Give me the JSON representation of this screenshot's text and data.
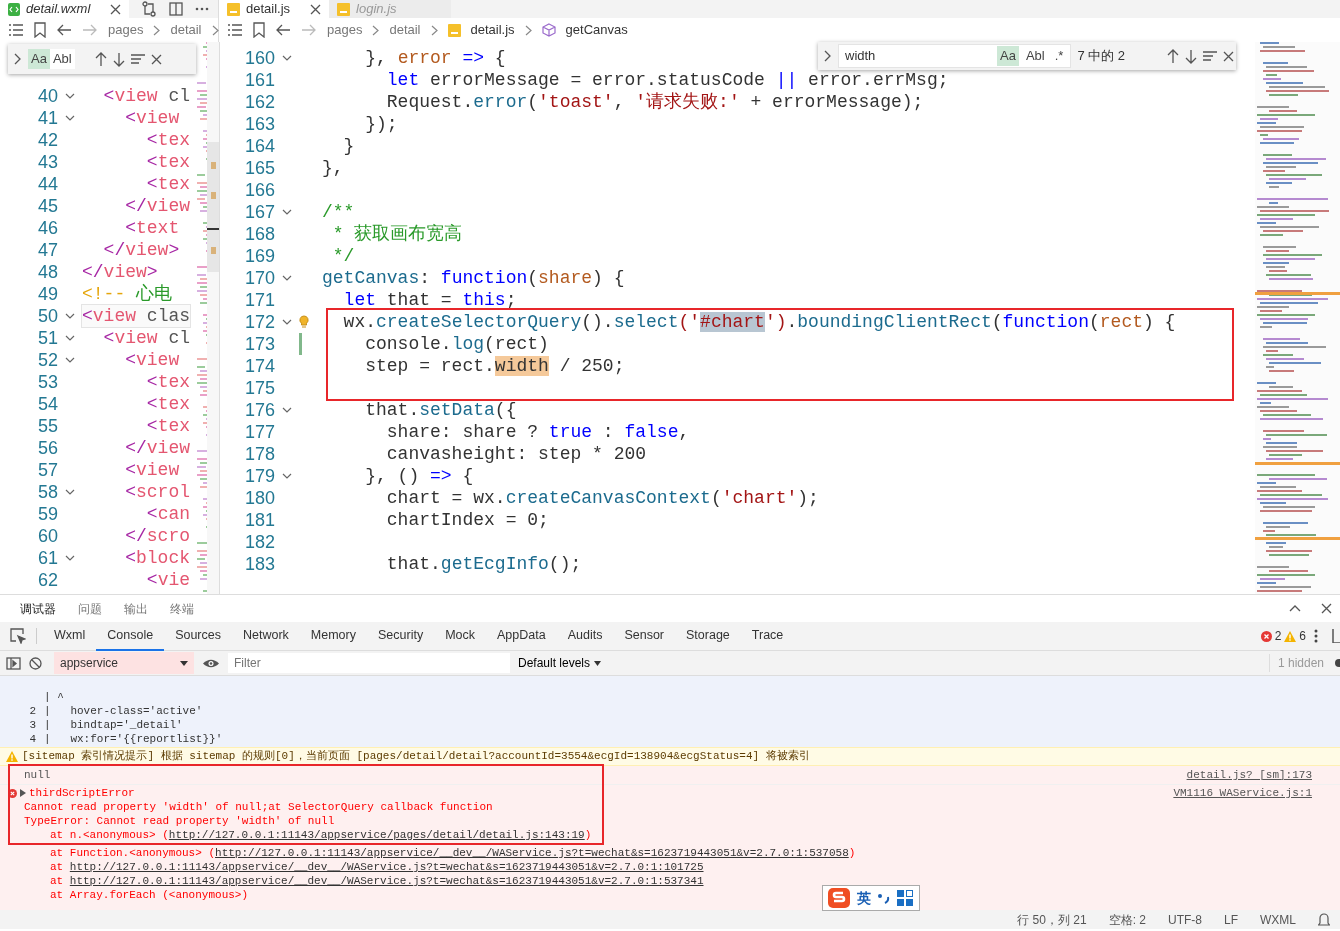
{
  "editor_left": {
    "tabs": [
      {
        "label": "detail.wxml",
        "selected": true,
        "preview": true
      }
    ],
    "crumbs": [
      "pages",
      "detail"
    ],
    "find": {
      "toggles": [
        {
          "label": "Aa",
          "selected": true
        },
        {
          "label": "Abl",
          "selected": false
        }
      ]
    },
    "lines": [
      {
        "n": "40",
        "fold": true,
        "current": false,
        "tokens": [
          {
            "text": "  <",
            "kind": "t"
          },
          {
            "text": "view",
            "kind": "tg"
          },
          {
            "text": " cl",
            "kind": "at"
          }
        ]
      },
      {
        "n": "41",
        "fold": true,
        "current": false,
        "tokens": [
          {
            "text": "    <",
            "kind": "t"
          },
          {
            "text": "view",
            "kind": "tg"
          }
        ]
      },
      {
        "n": "42",
        "fold": false,
        "current": false,
        "tokens": [
          {
            "text": "      <",
            "kind": "t"
          },
          {
            "text": "tex",
            "kind": "tg"
          }
        ]
      },
      {
        "n": "43",
        "fold": false,
        "current": false,
        "tokens": [
          {
            "text": "      <",
            "kind": "t"
          },
          {
            "text": "tex",
            "kind": "tg"
          }
        ]
      },
      {
        "n": "44",
        "fold": false,
        "current": false,
        "tokens": [
          {
            "text": "      <",
            "kind": "t"
          },
          {
            "text": "tex",
            "kind": "tg"
          }
        ]
      },
      {
        "n": "45",
        "fold": false,
        "current": false,
        "tokens": [
          {
            "text": "    </",
            "kind": "t"
          },
          {
            "text": "view",
            "kind": "tg"
          }
        ]
      },
      {
        "n": "46",
        "fold": false,
        "current": false,
        "tokens": [
          {
            "text": "    <",
            "kind": "t"
          },
          {
            "text": "text",
            "kind": "tg"
          }
        ]
      },
      {
        "n": "47",
        "fold": false,
        "current": false,
        "tokens": [
          {
            "text": "  </",
            "kind": "t"
          },
          {
            "text": "view",
            "kind": "tg"
          },
          {
            "text": ">",
            "kind": "t"
          }
        ]
      },
      {
        "n": "48",
        "fold": false,
        "current": false,
        "tokens": [
          {
            "text": "</",
            "kind": "t"
          },
          {
            "text": "view",
            "kind": "tg"
          },
          {
            "text": ">",
            "kind": "t"
          }
        ]
      },
      {
        "n": "49",
        "fold": false,
        "current": false,
        "tokens": [
          {
            "text": "<!-- ",
            "kind": "cp"
          },
          {
            "text": "心电",
            "kind": "cm"
          }
        ]
      },
      {
        "n": "50",
        "fold": true,
        "current": true,
        "tokens": [
          {
            "text": "<",
            "kind": "t"
          },
          {
            "text": "view",
            "kind": "tg"
          },
          {
            "text": " clas",
            "kind": "at"
          }
        ]
      },
      {
        "n": "51",
        "fold": true,
        "current": false,
        "tokens": [
          {
            "text": "  <",
            "kind": "t"
          },
          {
            "text": "view",
            "kind": "tg"
          },
          {
            "text": " cl",
            "kind": "at"
          }
        ]
      },
      {
        "n": "52",
        "fold": true,
        "current": false,
        "tokens": [
          {
            "text": "    <",
            "kind": "t"
          },
          {
            "text": "view",
            "kind": "tg"
          }
        ]
      },
      {
        "n": "53",
        "fold": false,
        "current": false,
        "tokens": [
          {
            "text": "      <",
            "kind": "t"
          },
          {
            "text": "tex",
            "kind": "tg"
          }
        ]
      },
      {
        "n": "54",
        "fold": false,
        "current": false,
        "tokens": [
          {
            "text": "      <",
            "kind": "t"
          },
          {
            "text": "tex",
            "kind": "tg"
          }
        ]
      },
      {
        "n": "55",
        "fold": false,
        "current": false,
        "tokens": [
          {
            "text": "      <",
            "kind": "t"
          },
          {
            "text": "tex",
            "kind": "tg"
          }
        ]
      },
      {
        "n": "56",
        "fold": false,
        "current": false,
        "tokens": [
          {
            "text": "    </",
            "kind": "t"
          },
          {
            "text": "view",
            "kind": "tg"
          }
        ]
      },
      {
        "n": "57",
        "fold": false,
        "current": false,
        "tokens": [
          {
            "text": "    <",
            "kind": "t"
          },
          {
            "text": "view",
            "kind": "tg"
          }
        ]
      },
      {
        "n": "58",
        "fold": true,
        "current": false,
        "tokens": [
          {
            "text": "    <",
            "kind": "t"
          },
          {
            "text": "scrol",
            "kind": "tg"
          }
        ]
      },
      {
        "n": "59",
        "fold": false,
        "current": false,
        "tokens": [
          {
            "text": "      <",
            "kind": "t"
          },
          {
            "text": "can",
            "kind": "tg"
          }
        ]
      },
      {
        "n": "60",
        "fold": false,
        "current": false,
        "tokens": [
          {
            "text": "    </",
            "kind": "t"
          },
          {
            "text": "scro",
            "kind": "tg"
          }
        ]
      },
      {
        "n": "61",
        "fold": true,
        "current": false,
        "tokens": [
          {
            "text": "    <",
            "kind": "t"
          },
          {
            "text": "block",
            "kind": "tg"
          }
        ]
      },
      {
        "n": "62",
        "fold": false,
        "current": false,
        "tokens": [
          {
            "text": "      <",
            "kind": "t"
          },
          {
            "text": "vie",
            "kind": "tg"
          }
        ]
      }
    ]
  },
  "editor_right": {
    "tabs": [
      {
        "label": "detail.js",
        "selected": true,
        "preview": false
      },
      {
        "label": "login.js",
        "selected": false,
        "preview": true
      }
    ],
    "crumbs": [
      {
        "label": "pages",
        "kind": "folder"
      },
      {
        "label": "detail",
        "kind": "folder"
      },
      {
        "label": "detail.js",
        "kind": "file"
      },
      {
        "label": "getCanvas",
        "kind": "symbol"
      }
    ],
    "find": {
      "value": "width",
      "count": "7 中的 2",
      "toggles": [
        {
          "label": "Aa",
          "selected": true
        },
        {
          "label": "Abl",
          "selected": false
        },
        {
          "label": ".*",
          "selected": false
        }
      ]
    },
    "lines": [
      {
        "n": "160",
        "fold": true,
        "tokens": [
          {
            "text": "    }, ",
            "kind": "pl"
          },
          {
            "text": "error",
            "kind": "pm"
          },
          {
            "text": " =>",
            "kind": "kw"
          },
          {
            "text": " {",
            "kind": "pl"
          }
        ]
      },
      {
        "n": "161",
        "fold": false,
        "tokens": [
          {
            "text": "      let",
            "kind": "kw"
          },
          {
            "text": " errorMessage = error.statusCode ",
            "kind": "pl"
          },
          {
            "text": "||",
            "kind": "kw"
          },
          {
            "text": " error.errMsg;",
            "kind": "pl"
          }
        ]
      },
      {
        "n": "162",
        "fold": false,
        "tokens": [
          {
            "text": "      Request.",
            "kind": "pl"
          },
          {
            "text": "error",
            "kind": "fn"
          },
          {
            "text": "(",
            "kind": "pl"
          },
          {
            "text": "'toast'",
            "kind": "str"
          },
          {
            "text": ", ",
            "kind": "pl"
          },
          {
            "text": "'请求失败:'",
            "kind": "str"
          },
          {
            "text": " + errorMessage);",
            "kind": "pl"
          }
        ]
      },
      {
        "n": "163",
        "fold": false,
        "tokens": [
          {
            "text": "    });",
            "kind": "pl"
          }
        ]
      },
      {
        "n": "164",
        "fold": false,
        "tokens": [
          {
            "text": "  }",
            "kind": "pl"
          }
        ]
      },
      {
        "n": "165",
        "fold": false,
        "tokens": [
          {
            "text": "},",
            "kind": "pl"
          }
        ]
      },
      {
        "n": "166",
        "fold": false
      },
      {
        "n": "167",
        "fold": true,
        "tokens": [
          {
            "text": "/**",
            "kind": "cm"
          }
        ]
      },
      {
        "n": "168",
        "fold": false,
        "tokens": [
          {
            "text": " * 获取画布宽高",
            "kind": "cm"
          }
        ]
      },
      {
        "n": "169",
        "fold": false,
        "tokens": [
          {
            "text": " */",
            "kind": "cm"
          }
        ]
      },
      {
        "n": "170",
        "fold": true,
        "tokens": [
          {
            "text": "getCanvas",
            "kind": "fn"
          },
          {
            "text": ": ",
            "kind": "pl"
          },
          {
            "text": "function",
            "kind": "kw"
          },
          {
            "text": "(",
            "kind": "pl"
          },
          {
            "text": "share",
            "kind": "pm"
          },
          {
            "text": ") {",
            "kind": "pl"
          }
        ]
      },
      {
        "n": "171",
        "fold": false,
        "tokens": [
          {
            "text": "  let",
            "kind": "kw"
          },
          {
            "text": " that = ",
            "kind": "pl"
          },
          {
            "text": "this",
            "kind": "kw"
          },
          {
            "text": ";",
            "kind": "pl"
          }
        ]
      },
      {
        "n": "172",
        "fold": true,
        "kind": "lightbulb",
        "tokens": [
          {
            "text": "  wx.",
            "kind": "pl"
          },
          {
            "text": "createSelectorQuery",
            "kind": "fn"
          },
          {
            "text": "().",
            "kind": "pl"
          },
          {
            "text": "select",
            "kind": "fn"
          },
          {
            "text": "('",
            "kind": "str"
          },
          {
            "text": "#chart",
            "kind": "m"
          },
          {
            "text": "')",
            "kind": "str"
          },
          {
            "text": ".",
            "kind": "pl"
          },
          {
            "text": "boundingClientRect",
            "kind": "fn"
          },
          {
            "text": "(",
            "kind": "pl"
          },
          {
            "text": "function",
            "kind": "kw"
          },
          {
            "text": "(",
            "kind": "pl"
          },
          {
            "text": "rect",
            "kind": "pm"
          },
          {
            "text": ") {",
            "kind": "pl"
          }
        ]
      },
      {
        "n": "173",
        "fold": false,
        "kind": "modified",
        "tokens": [
          {
            "text": "    console.",
            "kind": "pl"
          },
          {
            "text": "log",
            "kind": "fn"
          },
          {
            "text": "(rect)",
            "kind": "pl"
          }
        ]
      },
      {
        "n": "174",
        "fold": false,
        "tokens": [
          {
            "text": "    step = rect.",
            "kind": "pl"
          },
          {
            "text": "width",
            "kind": "mc"
          },
          {
            "text": " / 250;",
            "kind": "pl"
          }
        ]
      },
      {
        "n": "175",
        "fold": false
      },
      {
        "n": "176",
        "fold": true,
        "tokens": [
          {
            "text": "    that.",
            "kind": "pl"
          },
          {
            "text": "setData",
            "kind": "fn"
          },
          {
            "text": "({",
            "kind": "pl"
          }
        ]
      },
      {
        "n": "177",
        "fold": false,
        "tokens": [
          {
            "text": "      share: share ? ",
            "kind": "pl"
          },
          {
            "text": "true",
            "kind": "kw"
          },
          {
            "text": " : ",
            "kind": "pl"
          },
          {
            "text": "false",
            "kind": "kw"
          },
          {
            "text": ",",
            "kind": "pl"
          }
        ]
      },
      {
        "n": "178",
        "fold": false,
        "tokens": [
          {
            "text": "      canvasheight: step * 200",
            "kind": "pl"
          }
        ]
      },
      {
        "n": "179",
        "fold": true,
        "tokens": [
          {
            "text": "    }, () ",
            "kind": "pl"
          },
          {
            "text": "=>",
            "kind": "kw"
          },
          {
            "text": " {",
            "kind": "pl"
          }
        ]
      },
      {
        "n": "180",
        "fold": false,
        "tokens": [
          {
            "text": "      chart = wx.",
            "kind": "pl"
          },
          {
            "text": "createCanvasContext",
            "kind": "fn"
          },
          {
            "text": "(",
            "kind": "pl"
          },
          {
            "text": "'chart'",
            "kind": "str"
          },
          {
            "text": ");",
            "kind": "pl"
          }
        ]
      },
      {
        "n": "181",
        "fold": false,
        "tokens": [
          {
            "text": "      chartIndex = 0;",
            "kind": "pl"
          }
        ]
      },
      {
        "n": "182",
        "fold": false
      },
      {
        "n": "183",
        "fold": false,
        "tokens": [
          {
            "text": "      that.",
            "kind": "pl"
          },
          {
            "text": "getEcgInfo",
            "kind": "fn"
          },
          {
            "text": "();",
            "kind": "pl"
          }
        ]
      }
    ]
  },
  "devtools": {
    "tabs": [
      {
        "label": "调试器",
        "selected": true
      },
      {
        "label": "问题",
        "selected": false
      },
      {
        "label": "输出",
        "selected": false
      },
      {
        "label": "终端",
        "selected": false
      }
    ],
    "panels": [
      {
        "label": "Wxml",
        "selected": false
      },
      {
        "label": "Console",
        "selected": true
      },
      {
        "label": "Sources",
        "selected": false
      },
      {
        "label": "Network",
        "selected": false
      },
      {
        "label": "Memory",
        "selected": false
      },
      {
        "label": "Security",
        "selected": false
      },
      {
        "label": "Mock",
        "selected": false
      },
      {
        "label": "AppData",
        "selected": false
      },
      {
        "label": "Audits",
        "selected": false
      },
      {
        "label": "Sensor",
        "selected": false
      },
      {
        "label": "Storage",
        "selected": false
      },
      {
        "label": "Trace",
        "selected": false
      }
    ],
    "errors": "2",
    "warnings": "6",
    "context": "appservice",
    "filter_placeholder": "Filter",
    "levels": "Default levels",
    "hidden": "1 hidden"
  },
  "console": {
    "snippet": [
      {
        "code": "| ^"
      },
      {
        "num": "2",
        "code": "|   hover-class='active'"
      },
      {
        "num": "3",
        "code": "|   bindtap='_detail'"
      },
      {
        "num": "4",
        "code": "|   wx:for='{{reportlist}}'"
      }
    ],
    "messages": [
      {
        "kind": "warning",
        "text": "[sitemap 索引情况提示] 根据 sitemap 的规则[0]，当前页面 [pages/detail/detail?accountId=3554&ecgId=138904&ecgStatus=4] 将被索引"
      },
      {
        "kind": "log",
        "text": "null",
        "source": "detail.js? [sm]:173"
      },
      {
        "kind": "error",
        "text": "thirdScriptError",
        "source": "VM1116 WAService.js:1",
        "details": [
          "Cannot read property 'width' of null;at SelectorQuery callback function",
          "TypeError: Cannot read property 'width' of null"
        ],
        "stack": [
          {
            "prefix": "at n.<anonymous> (",
            "link": "http://127.0.0.1:11143/appservice/pages/detail/detail.js:143:19",
            "suffix": ")"
          },
          {
            "prefix": "at Function.<anonymous> (",
            "link": "http://127.0.0.1:11143/appservice/__dev__/WAService.js?t=wechat&s=1623719443051&v=2.7.0:1:537058",
            "suffix": ")"
          },
          {
            "prefix": "at ",
            "link": "http://127.0.0.1:11143/appservice/__dev__/WAService.js?t=wechat&s=1623719443051&v=2.7.0:1:101725"
          },
          {
            "prefix": "at ",
            "link": "http://127.0.0.1:11143/appservice/__dev__/WAService.js?t=wechat&s=1623719443051&v=2.7.0:1:537341"
          },
          {
            "prefix": "at Array.forEach (<anonymous>)"
          }
        ]
      }
    ]
  },
  "ime": {
    "mode": "英"
  },
  "status_bar": [
    "行 50，列 21",
    "空格: 2",
    "UTF-8",
    "LF",
    "WXML"
  ]
}
